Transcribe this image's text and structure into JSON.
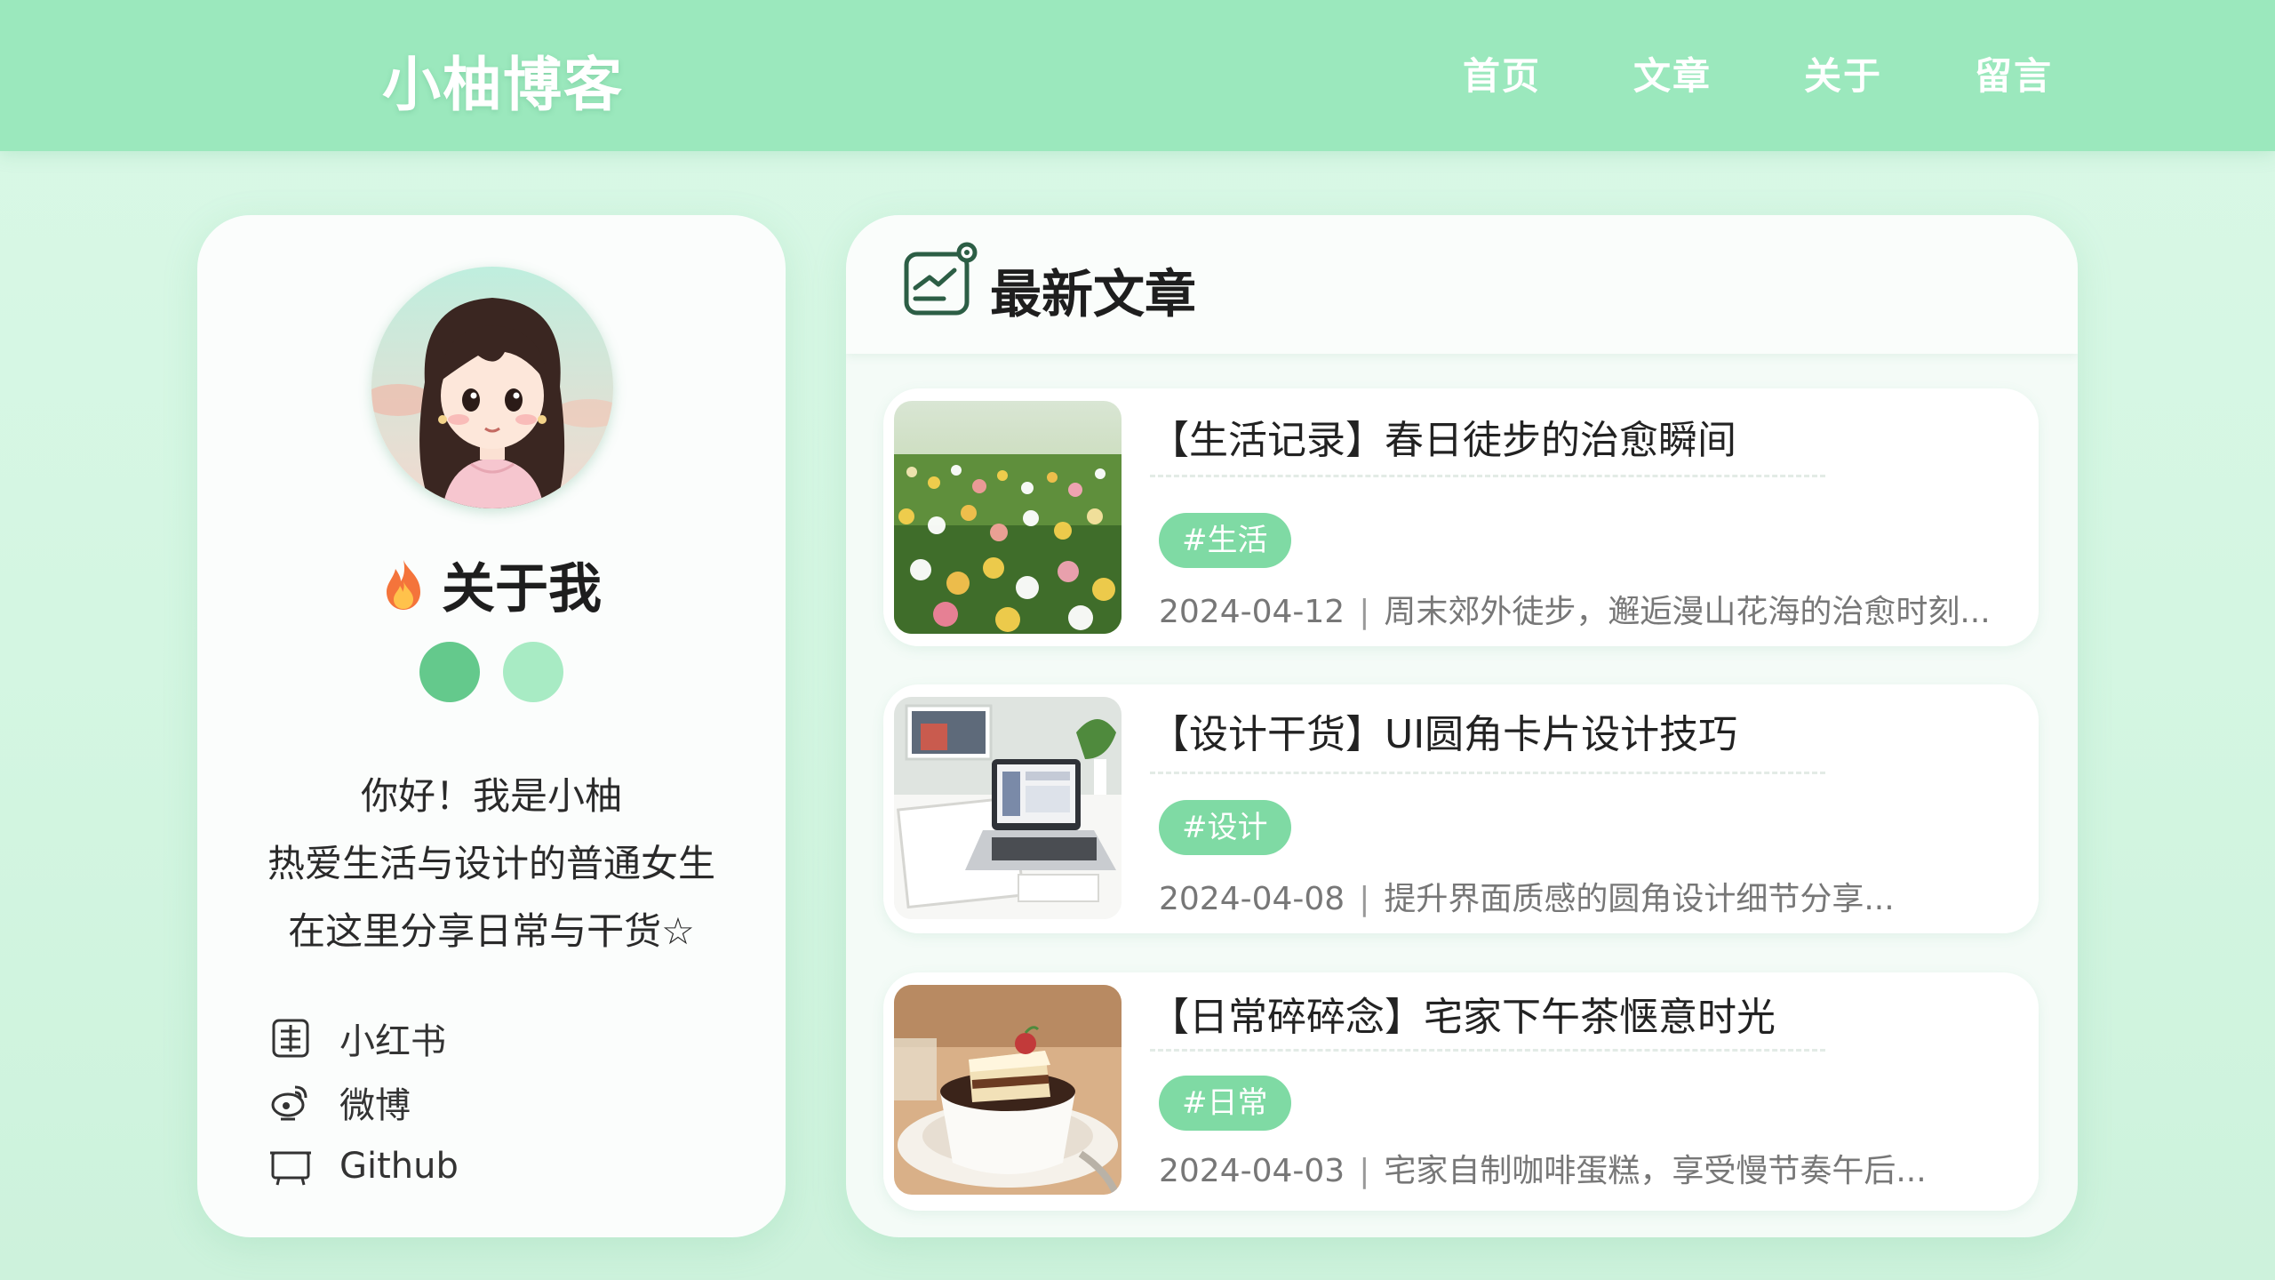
{
  "header": {
    "brand": "小柚博客",
    "nav": [
      "首页",
      "文章",
      "关于",
      "留言"
    ]
  },
  "profile": {
    "title": "关于我",
    "intro": [
      "你好！我是小柚",
      "热爱生活与设计的普通女生",
      "在这里分享日常与干货☆"
    ],
    "socials": [
      {
        "label": "小红书",
        "icon": "book-icon"
      },
      {
        "label": "微博",
        "icon": "weibo-icon"
      },
      {
        "label": "Github",
        "icon": "github-icon"
      }
    ]
  },
  "articles": {
    "heading": "最新文章",
    "items": [
      {
        "title": "【生活记录】春日徒步的治愈瞬间",
        "tag": "#生活",
        "date": "2024-04-12",
        "excerpt": "周末郊外徒步，邂逅漫山花海的治愈时刻...",
        "thumb": "flower-field-photo"
      },
      {
        "title": "【设计干货】UI圆角卡片设计技巧",
        "tag": "#设计",
        "date": "2024-04-08",
        "excerpt": "提升界面质感的圆角设计细节分享...",
        "thumb": "laptop-desk-photo"
      },
      {
        "title": "【日常碎碎念】宅家下午茶惬意时光",
        "tag": "#日常",
        "date": "2024-04-03",
        "excerpt": "宅家自制咖啡蛋糕，享受慢节奏午后...",
        "thumb": "coffee-cake-photo"
      }
    ]
  },
  "colors": {
    "header_bg": "#9be8bd",
    "accent": "#64c98c",
    "accent_light": "#a8ebc4",
    "tag_bg": "#7fdaa4"
  }
}
